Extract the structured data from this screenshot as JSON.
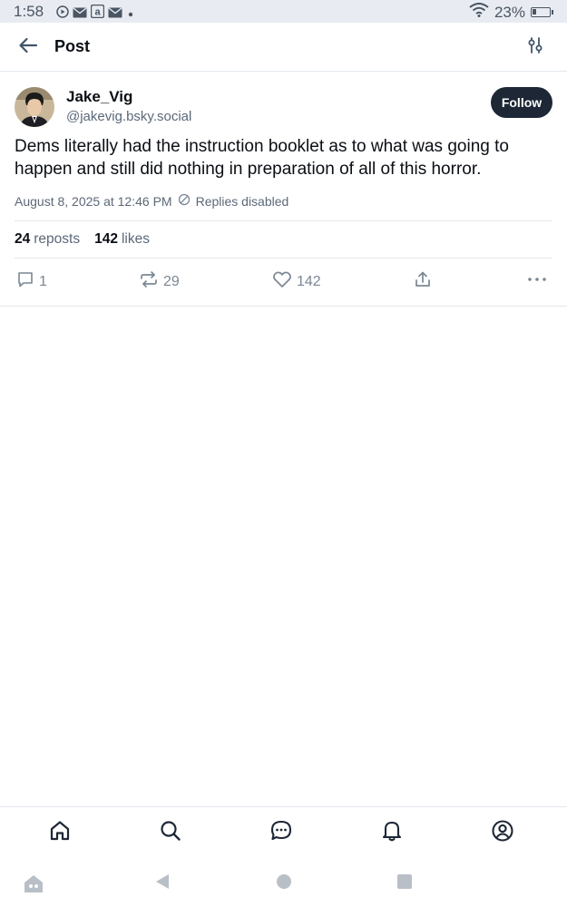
{
  "status_bar": {
    "time": "1:58",
    "battery_text": "23%",
    "battery_level": 0.23,
    "notification_icons": [
      "play-circle-icon",
      "mail-icon",
      "amazon-icon",
      "mail-icon",
      "dot-icon"
    ]
  },
  "header": {
    "title": "Post",
    "back_icon": "arrow-left-icon",
    "filter_icon": "sliders-icon"
  },
  "post": {
    "author": {
      "display_name": "Jake_Vig",
      "handle": "@jakevig.bsky.social"
    },
    "follow_label": "Follow",
    "text": "Dems literally had the instruction booklet as to what was going to happen and still did nothing in preparation of all of this horror.",
    "timestamp": "August 8, 2025 at 12:46 PM",
    "replies_status": "Replies disabled",
    "reposts_count": "24",
    "reposts_label": "reposts",
    "likes_count": "142",
    "likes_label": "likes",
    "actions": {
      "reply_count": "1",
      "repost_count": "29",
      "like_count": "142"
    }
  },
  "bottom_nav": [
    "home-icon",
    "search-icon",
    "chat-icon",
    "bell-icon",
    "profile-icon"
  ],
  "colors": {
    "accent_dark": "#1d2736",
    "muted_text": "#5b6878",
    "icon_muted": "#7b8794",
    "divider": "#e3e7ec",
    "status_bar_bg": "#e8ecf2"
  }
}
